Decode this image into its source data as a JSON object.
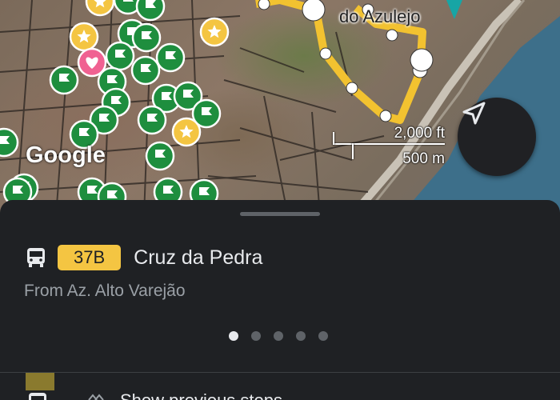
{
  "map": {
    "provider_logo": "Google",
    "place_label": "do Azulejo",
    "scale_ft": "2,000 ft",
    "scale_m": "500 m",
    "route_color": "#f2c230",
    "marker_color": "#1e8e3e",
    "favorite_color": "#f06292",
    "water_color": "#3d6f8a",
    "icons": [
      "flag-icon",
      "star-icon",
      "heart-icon",
      "location-pin-icon",
      "navigation-arrow-icon"
    ]
  },
  "route": {
    "icon": "bus-icon",
    "number": "37B",
    "badge_color": "#f4c542",
    "destination": "Cruz da Pedra",
    "origin": "From Az. Alto Varejão"
  },
  "pager": {
    "total": 5,
    "active": 1
  },
  "bottom": {
    "label": "Show previous stops"
  }
}
